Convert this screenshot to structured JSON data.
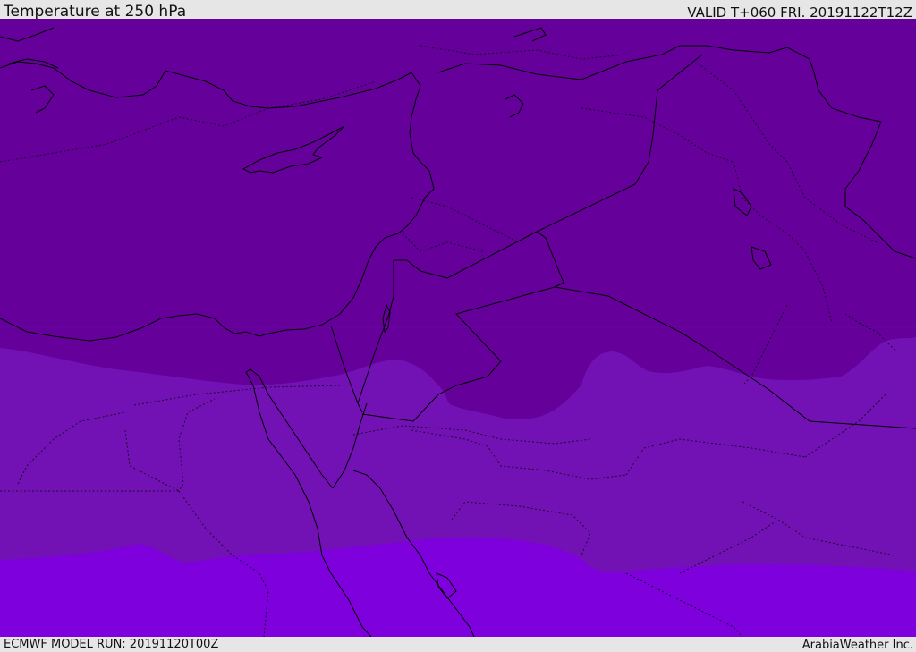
{
  "header": {
    "title": "Temperature at 250 hPa",
    "valid_time": "VALID T+060 FRI. 20191122T12Z"
  },
  "footer": {
    "model_run": "ECMWF MODEL RUN: 20191120T00Z",
    "credit": "ArabiaWeather Inc."
  },
  "colors": {
    "band_cold": "#65009a",
    "band_mid": "#7212b4",
    "band_warm": "#7d00dd",
    "coastline": "#000000",
    "borders": "#1a0a2a",
    "frame_bg": "#e6e6e6"
  }
}
